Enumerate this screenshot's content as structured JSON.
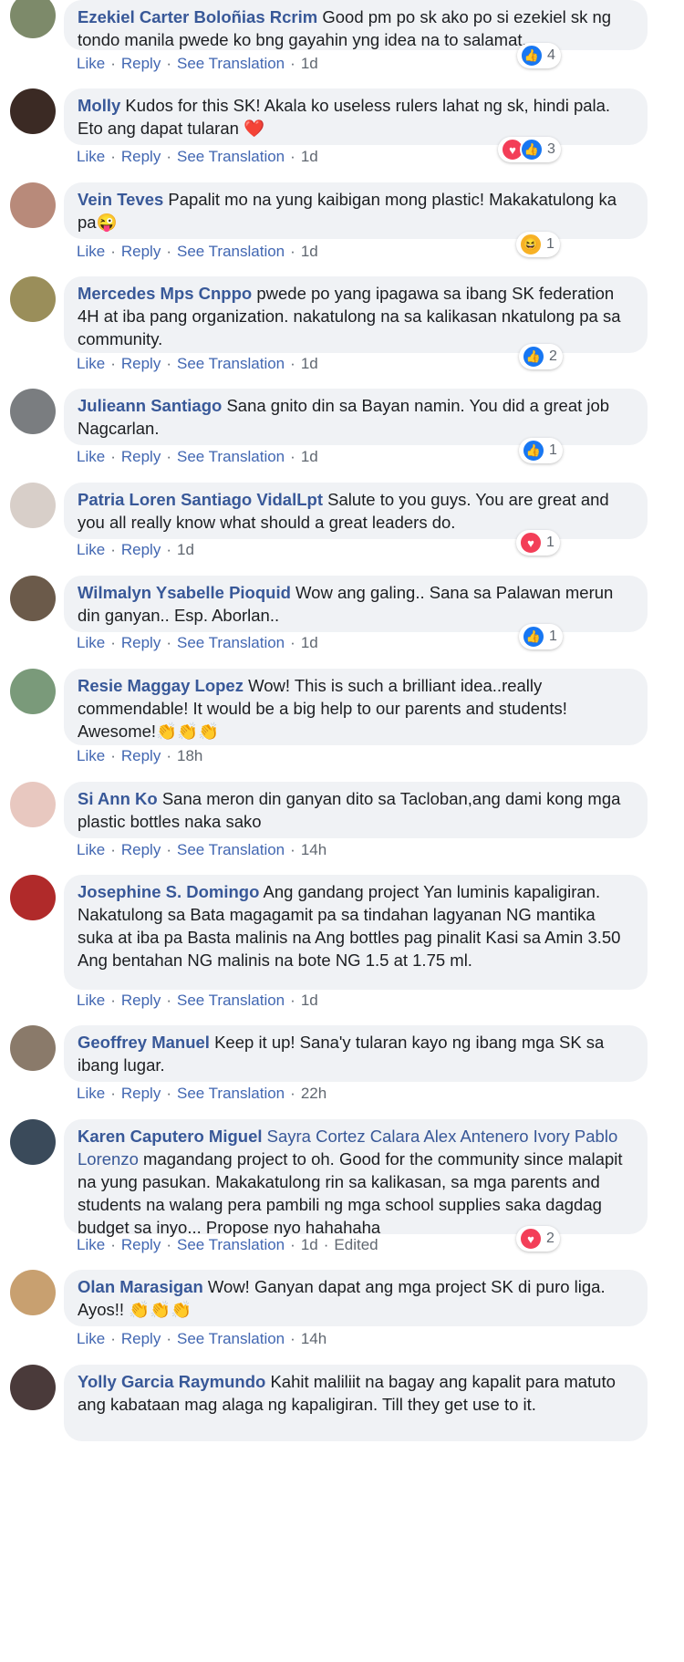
{
  "colors": {
    "author": "#385898",
    "link": "#4267b2",
    "bubble": "#f0f2f5",
    "like": "#1877f2",
    "love": "#f33e58",
    "haha": "#f7b125"
  },
  "actions": {
    "like": "Like",
    "reply": "Reply",
    "see_translation": "See Translation",
    "separator": "·"
  },
  "comments": [
    {
      "author": "Ezekiel Carter Boloñias Rcrim",
      "text": "Good pm po sk ako po si ezekiel sk ng tondo manila pwede ko bng gayahin yng idea na to salamat.",
      "time": "1d",
      "reactions": {
        "icons": [
          "like"
        ],
        "count": "4"
      }
    },
    {
      "author": "Molly",
      "text": "Kudos for this SK! Akala ko useless rulers lahat ng sk, hindi pala. Eto ang dapat tularan ❤️",
      "time": "1d",
      "reactions": {
        "icons": [
          "love",
          "like"
        ],
        "count": "3"
      }
    },
    {
      "author": "Vein Teves",
      "text": "Papalit mo na yung kaibigan mong plastic! Makakatulong ka pa😜",
      "time": "1d",
      "reactions": {
        "icons": [
          "haha"
        ],
        "count": "1"
      }
    },
    {
      "author": "Mercedes Mps Cnppo",
      "text": "pwede po yang ipagawa sa ibang SK federation 4H at iba pang organization. nakatulong na sa kalikasan nkatulong pa sa community.",
      "time": "1d",
      "reactions": {
        "icons": [
          "like"
        ],
        "count": "2"
      }
    },
    {
      "author": "Julieann Santiago",
      "text": "Sana gnito din sa Bayan namin. You did a great job Nagcarlan.",
      "time": "1d",
      "reactions": {
        "icons": [
          "like"
        ],
        "count": "1"
      }
    },
    {
      "author": "Patria Loren Santiago VidalLpt",
      "text": "Salute to you guys. You are great and you all really know what should a great leaders do.",
      "time": "1d",
      "no_translation": true,
      "reactions": {
        "icons": [
          "love"
        ],
        "count": "1"
      }
    },
    {
      "author": "Wilmalyn Ysabelle Pioquid",
      "text": "Wow ang galing.. Sana sa Palawan merun din ganyan.. Esp. Aborlan..",
      "time": "1d",
      "reactions": {
        "icons": [
          "like"
        ],
        "count": "1"
      }
    },
    {
      "author": "Resie Maggay Lopez",
      "text": "Wow! This is such a brilliant idea..really commendable! It would be a big help to our parents and students! Awesome!👏👏👏",
      "time": "18h",
      "no_translation": true
    },
    {
      "author": "Si Ann Ko",
      "text": "Sana meron din ganyan dito sa Tacloban,ang dami kong mga plastic bottles naka sako",
      "time": "14h"
    },
    {
      "author": "Josephine S. Domingo",
      "text": "Ang gandang project Yan luminis kapaligiran. Nakatulong sa Bata magagamit pa sa tindahan lagyanan NG mantika suka at iba pa Basta malinis na Ang bottles pag pinalit Kasi sa Amin 3.50 Ang bentahan NG malinis na bote NG 1.5 at 1.75 ml.",
      "time": "1d"
    },
    {
      "author": "Geoffrey Manuel",
      "text": "Keep it up! Sana'y tularan kayo ng ibang mga SK sa ibang lugar.",
      "time": "22h"
    },
    {
      "author": "Karen Caputero Miguel",
      "tags": "Sayra Cortez Calara Alex Antenero Ivory Pablo Lorenzo",
      "text": "magandang project to oh. Good for the community since malapit na yung pasukan. Makakatulong rin sa kalikasan, sa mga parents and students na walang pera pambili ng mga school supplies saka dagdag budget sa inyo... Propose nyo hahahaha",
      "time": "1d",
      "edited": "Edited",
      "reactions": {
        "icons": [
          "love"
        ],
        "count": "2"
      }
    },
    {
      "author": "Olan Marasigan",
      "text": "Wow! Ganyan dapat ang mga project SK di puro liga. Ayos!! 👏👏👏",
      "time": "14h"
    },
    {
      "author": "Yolly Garcia Raymundo",
      "text": "Kahit maliliit na bagay ang kapalit para matuto ang kabataan mag alaga ng kapaligiran. Till they get use to it.",
      "time": ""
    }
  ]
}
